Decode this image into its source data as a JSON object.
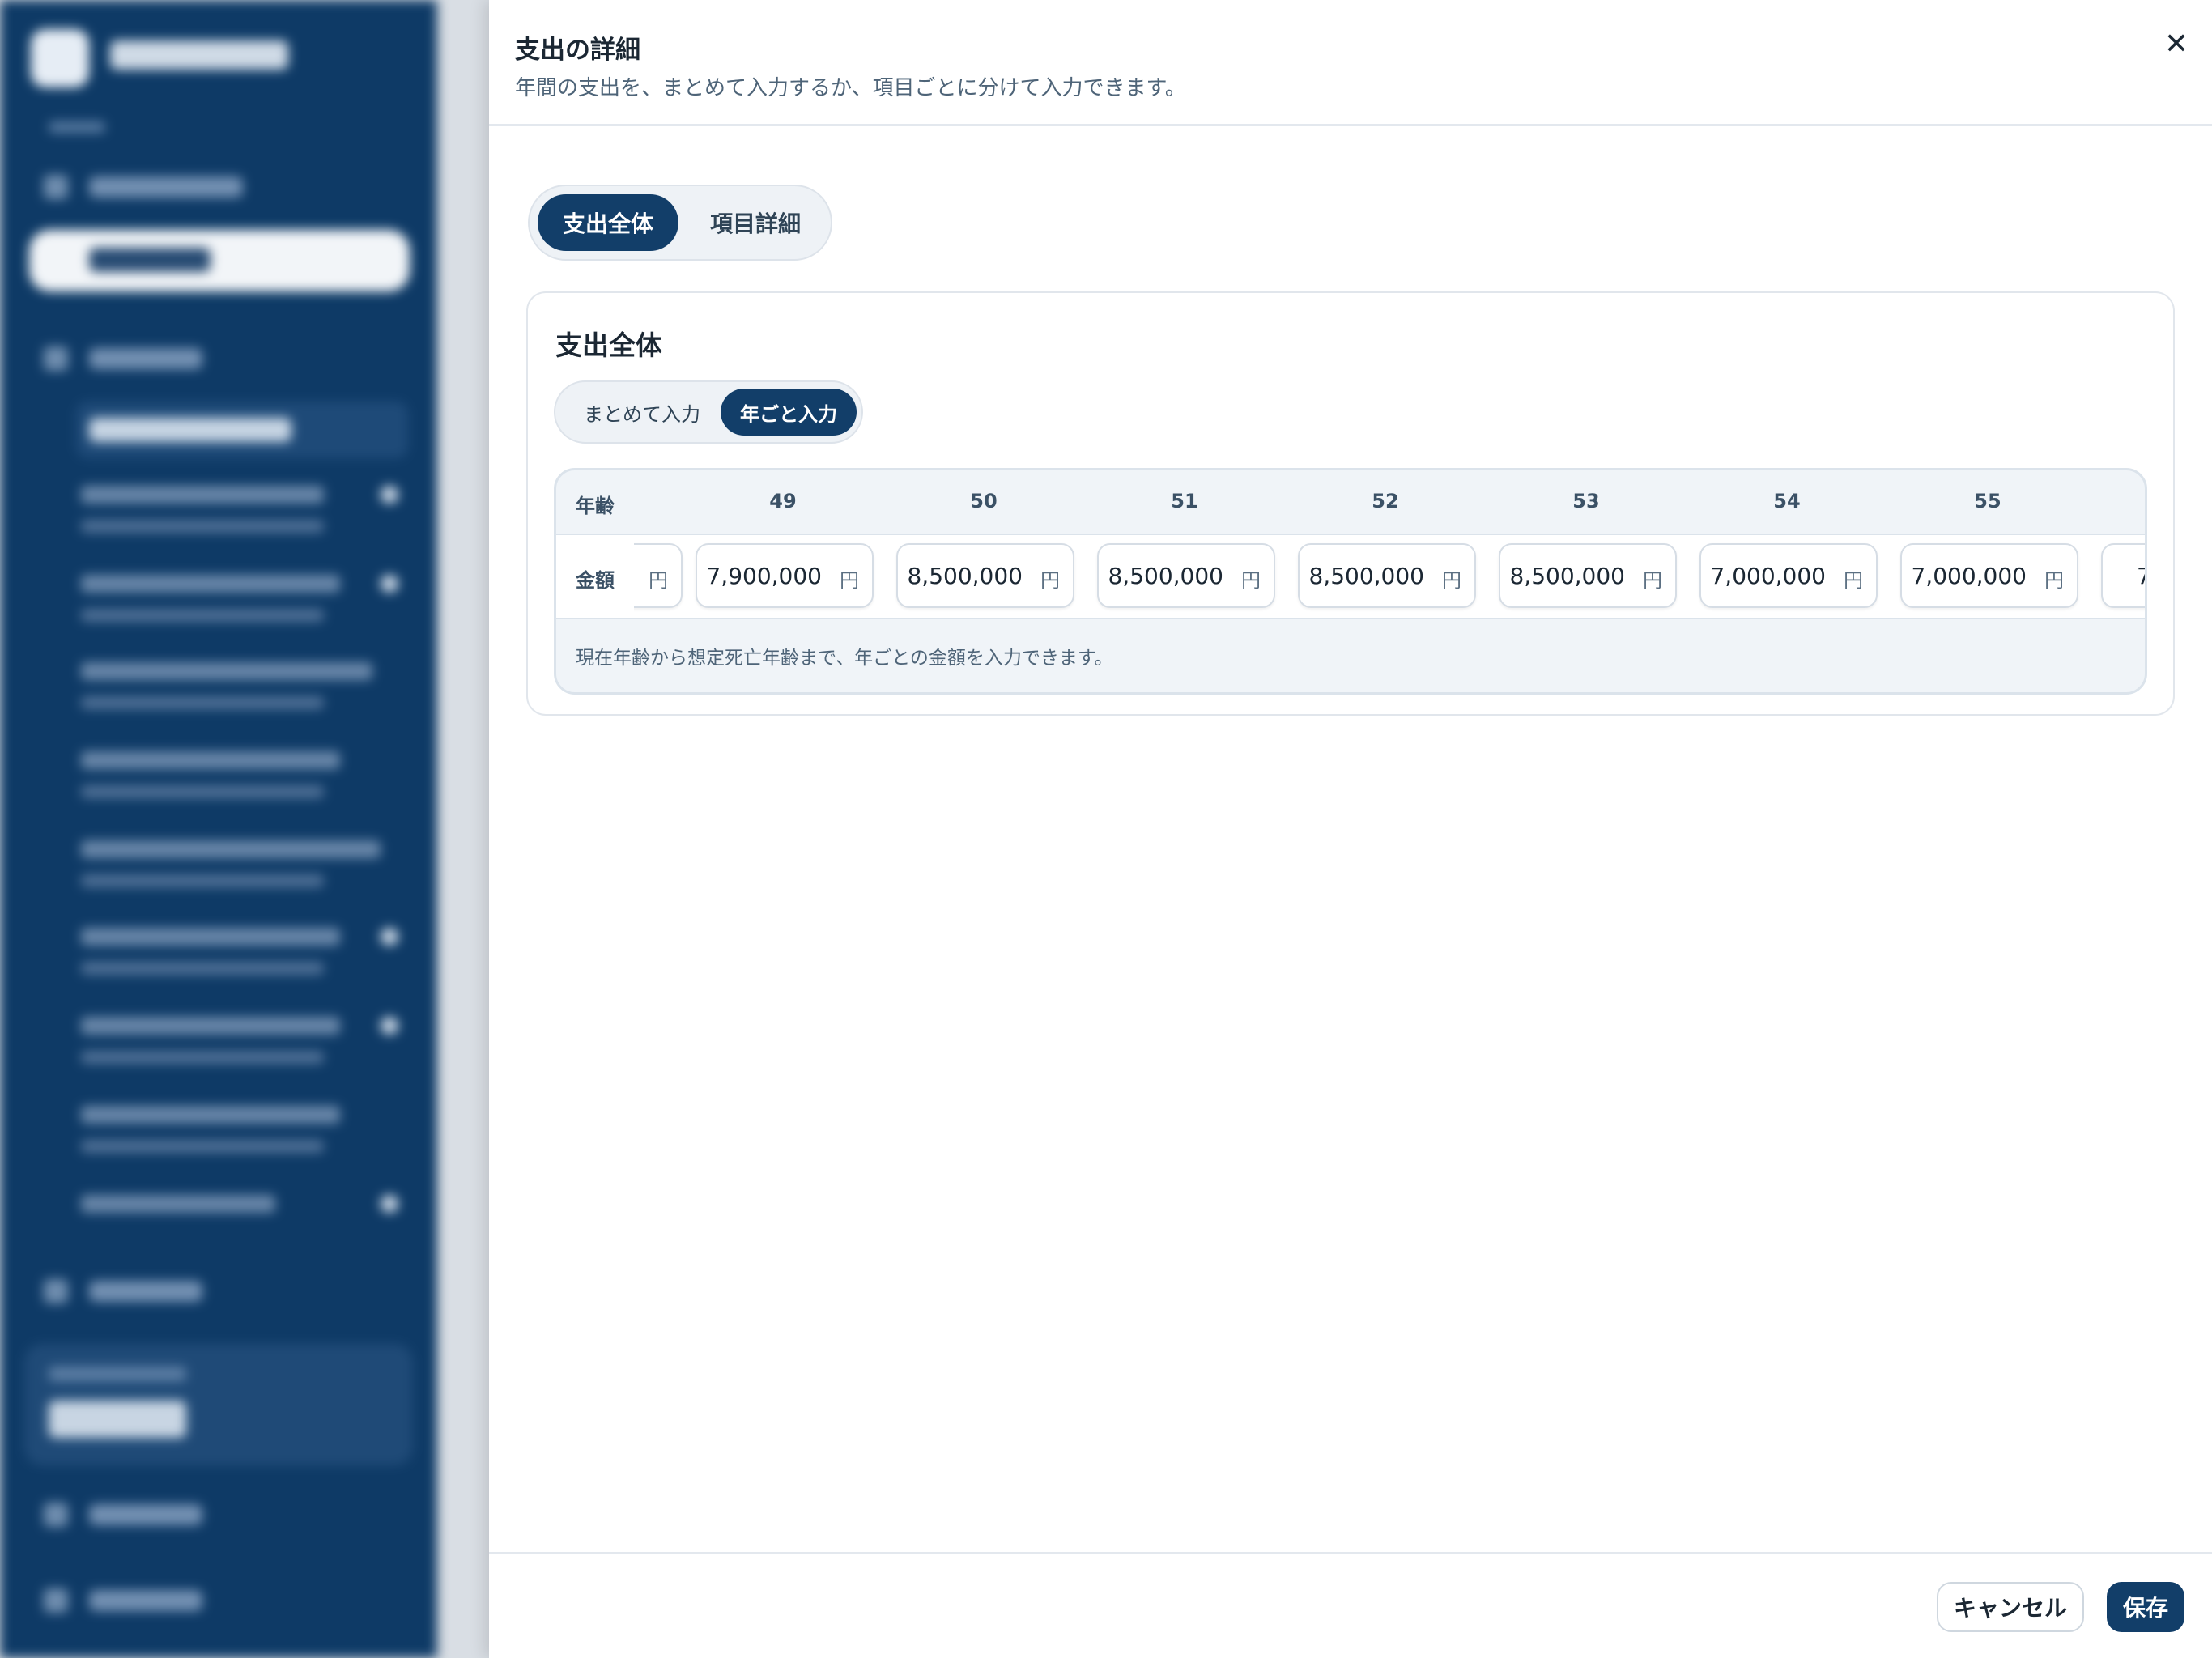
{
  "modal": {
    "title": "支出の詳細",
    "description": "年間の支出を、まとめて入力するか、項目ごとに分けて入力できます。",
    "close_icon": "close-icon",
    "close_symbol": "✕"
  },
  "main_tabs": {
    "active": "支出全体",
    "inactive": "項目詳細"
  },
  "card": {
    "title": "支出全体",
    "sub_tabs": {
      "bulk": "まとめて入力",
      "yearly": "年ごと入力",
      "selected": "yearly"
    }
  },
  "table": {
    "age_label": "年齢",
    "amount_label": "金額",
    "ages": [
      "49",
      "50",
      "51",
      "52",
      "53",
      "54",
      "55"
    ],
    "amounts": [
      "7,900,000",
      "8,500,000",
      "8,500,000",
      "8,500,000",
      "8,500,000",
      "7,000,000",
      "7,000,000"
    ],
    "partial_left_unit": "円",
    "partial_right_value": "7",
    "unit": "円",
    "note": "現在年齢から想定死亡年齢まで、年ごとの金額を入力できます。"
  },
  "footer": {
    "cancel": "キャンセル",
    "save": "保存"
  },
  "colors": {
    "sidebar": "#0e3a66",
    "accent": "#123e69",
    "table_bg": "#f0f4f8"
  }
}
